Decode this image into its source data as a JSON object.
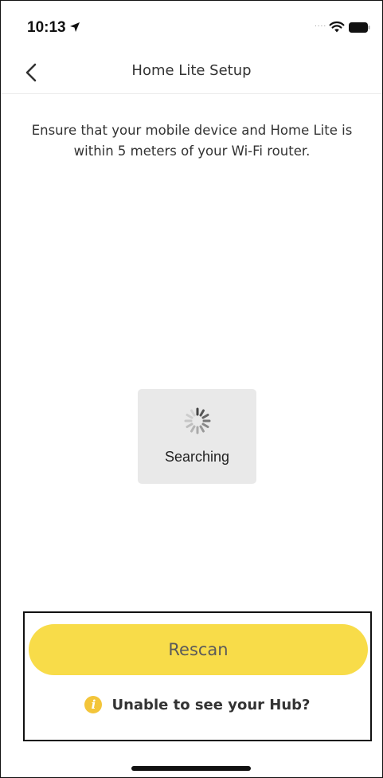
{
  "status_bar": {
    "time": "10:13",
    "location_icon": "location-arrow-icon",
    "signal_text": "....",
    "wifi_icon": "wifi-icon",
    "battery_icon": "battery-icon"
  },
  "nav": {
    "back_icon": "chevron-left-icon",
    "title": "Home Lite Setup"
  },
  "main": {
    "instruction": "Ensure that your mobile device and Home Lite is within 5 meters of your Wi-Fi router.",
    "searching": {
      "icon": "spinner-icon",
      "label": "Searching"
    }
  },
  "actions": {
    "rescan_label": "Rescan",
    "help_icon": "info-icon",
    "help_icon_glyph": "i",
    "help_label": "Unable to see your Hub?"
  },
  "colors": {
    "accent_yellow": "#f8dc49",
    "info_yellow": "#f3c53a",
    "hud_background": "#e9e9e9"
  }
}
